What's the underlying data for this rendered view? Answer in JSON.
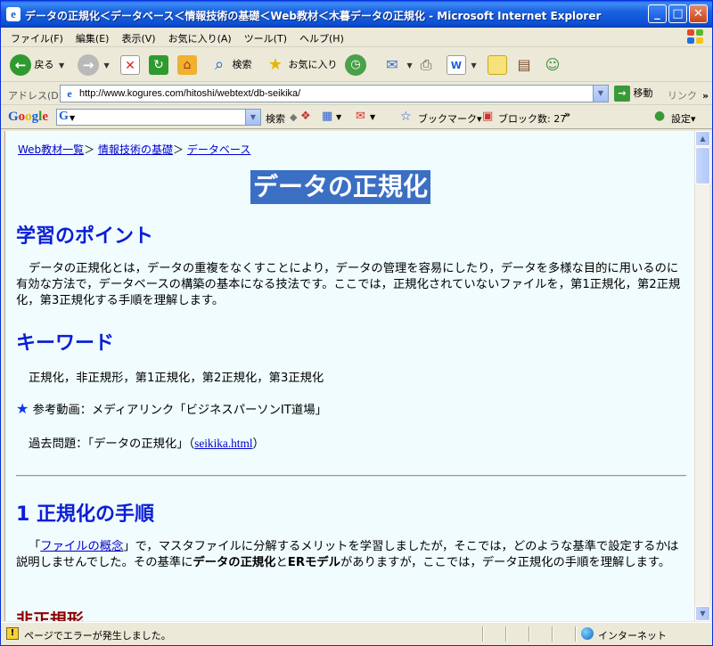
{
  "window": {
    "title": "データの正規化＜データベース＜情報技術の基礎＜Web教材＜木暮データの正規化 - Microsoft Internet Explorer",
    "min": "_",
    "max": "□",
    "close": "✕"
  },
  "menu": [
    "ファイル(F)",
    "編集(E)",
    "表示(V)",
    "お気に入り(A)",
    "ツール(T)",
    "ヘルプ(H)"
  ],
  "toolbar": {
    "back": "戻る",
    "search": "検索",
    "favorites": "お気に入り"
  },
  "address": {
    "label": "アドレス(D)",
    "url": "http://www.kogures.com/hitoshi/webtext/db-seikika/",
    "go": "移動",
    "links": "リンク"
  },
  "google": {
    "logo": "Google",
    "search": "検索",
    "bookmarks": "ブックマーク▾",
    "block_label": "ブロック数: 27",
    "settings": "設定▾"
  },
  "page": {
    "breadcrumb": {
      "link1": "Web教材一覧",
      "sep1": "＞",
      "link2": "情報技術の基礎",
      "sep2": "＞",
      "link3": "データベース"
    },
    "title": "データの正規化",
    "section1": {
      "heading": "学習のポイント",
      "body": "データの正規化とは，データの重複をなくすことにより，データの管理を容易にしたり，データを多様な目的に用いるのに有効な方法で，データベースの構築の基本になる技法です。ここでは，正規化されていないファイルを，第1正規化，第2正規化，第3正規化する手順を理解します。"
    },
    "section2": {
      "heading": "キーワード",
      "keywords": "正規化，非正規形，第1正規化，第2正規化，第3正規化",
      "video_star": "★",
      "video": "参考動画：メディアリンク「ビジネスパーソンIT道場」",
      "past_prefix": "過去問題：「データの正規化」（",
      "past_link": "seikika.html",
      "past_suffix": "）"
    },
    "section3": {
      "heading": "1 正規化の手順",
      "p_open": "「",
      "p_link": "ファイルの概念",
      "p_mid": "」で，マスタファイルに分解するメリットを学習しましたが，そこでは，どのような基準で設定するかは説明しませんでした。その基準に",
      "p_bold1": "データの正規化",
      "p_and": "と",
      "p_bold2": "ERモデル",
      "p_end": "がありますが，ここでは，データ正規化の手順を理解します。",
      "subheading": "非正規形"
    }
  },
  "status": {
    "warn_icon": "!",
    "message": "ページでエラーが発生しました。",
    "zone": "インターネット"
  },
  "colors": {
    "title_bg": "#3a6fc4",
    "heading": "#0a1ed6",
    "content_bg": "#f0fcfd",
    "subheading": "#8a0000"
  }
}
